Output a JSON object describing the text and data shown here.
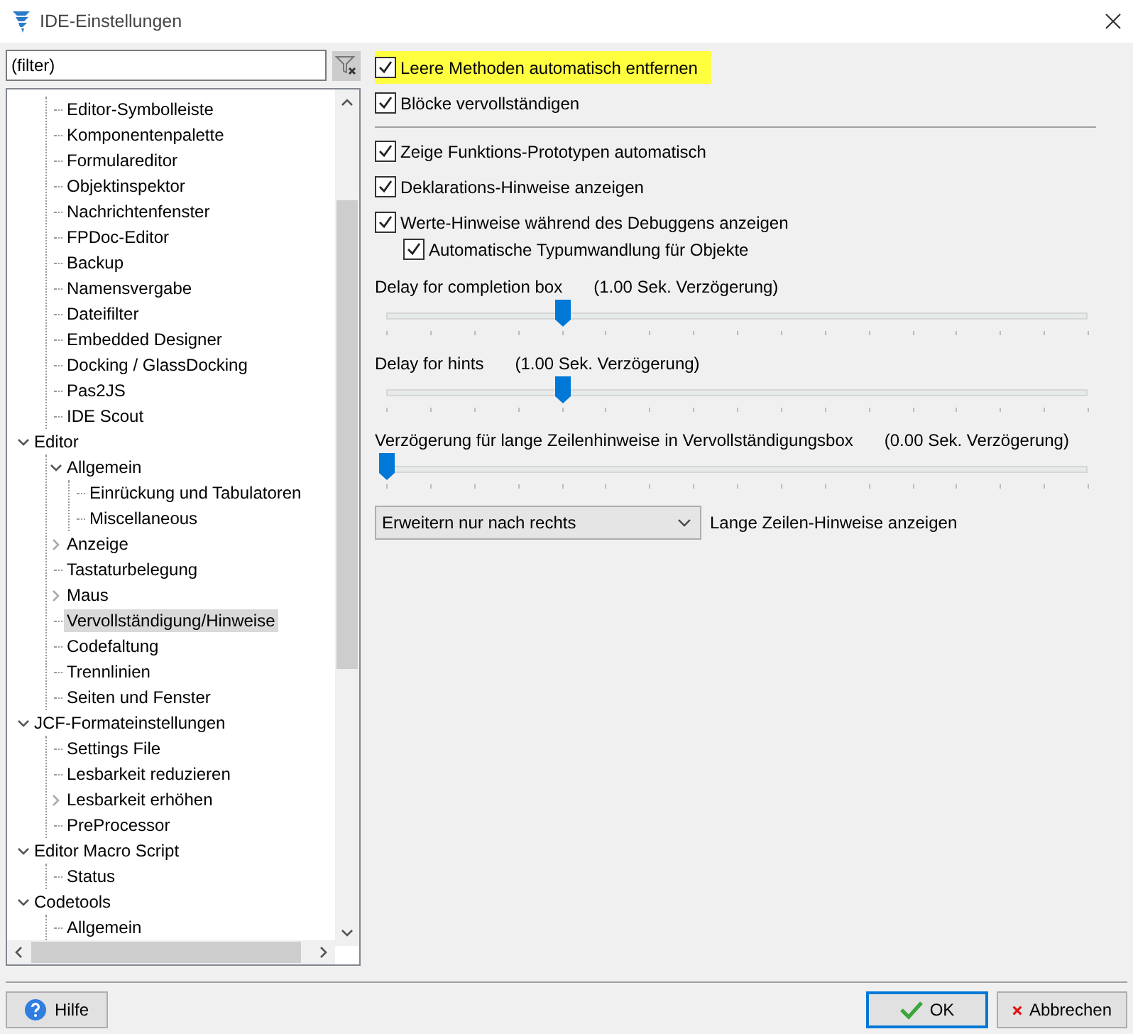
{
  "window": {
    "title": "IDE-Einstellungen"
  },
  "filter": {
    "placeholder": "(filter)"
  },
  "tree": [
    {
      "children": [
        {
          "label": "Editor-Symbolleiste",
          "selected": false
        },
        {
          "label": "Komponentenpalette",
          "selected": false
        },
        {
          "label": "Formulareditor",
          "selected": false
        },
        {
          "label": "Objektinspektor",
          "selected": false
        },
        {
          "label": "Nachrichtenfenster",
          "selected": false
        },
        {
          "label": "FPDoc-Editor",
          "selected": false
        },
        {
          "label": "Backup",
          "selected": false
        },
        {
          "label": "Namensvergabe",
          "selected": false
        },
        {
          "label": "Dateifilter",
          "selected": false
        },
        {
          "label": "Embedded Designer",
          "selected": false
        },
        {
          "label": "Docking / GlassDocking",
          "selected": false
        },
        {
          "label": "Pas2JS",
          "selected": false
        },
        {
          "label": "IDE Scout",
          "selected": false
        }
      ]
    },
    {
      "label": "Editor",
      "expanded": true,
      "selected": false,
      "children": [
        {
          "label": "Allgemein",
          "expanded": true,
          "selected": false,
          "children": [
            {
              "label": "Einrückung und Tabulatoren",
              "selected": false
            },
            {
              "label": "Miscellaneous",
              "selected": false
            }
          ]
        },
        {
          "label": "Anzeige",
          "expanded": false,
          "selected": false
        },
        {
          "label": "Tastaturbelegung",
          "selected": false
        },
        {
          "label": "Maus",
          "expanded": false,
          "selected": false
        },
        {
          "label": "Vervollständigung/Hinweise",
          "selected": true
        },
        {
          "label": "Codefaltung",
          "selected": false
        },
        {
          "label": "Trennlinien",
          "selected": false
        },
        {
          "label": "Seiten und Fenster",
          "selected": false
        }
      ]
    },
    {
      "label": "JCF-Formateinstellungen",
      "expanded": true,
      "selected": false,
      "children": [
        {
          "label": "Settings File",
          "selected": false
        },
        {
          "label": "Lesbarkeit reduzieren",
          "selected": false
        },
        {
          "label": "Lesbarkeit erhöhen",
          "expanded": false,
          "selected": false
        },
        {
          "label": "PreProcessor",
          "selected": false
        }
      ]
    },
    {
      "label": "Editor Macro Script",
      "expanded": true,
      "selected": false,
      "children": [
        {
          "label": "Status",
          "selected": false
        }
      ]
    },
    {
      "label": "Codetools",
      "expanded": true,
      "selected": false,
      "children": [
        {
          "label": "Allgemein",
          "selected": false
        }
      ]
    }
  ],
  "options": [
    {
      "kind": "checkbox",
      "label": "Leere Methoden automatisch entfernen",
      "checked": true,
      "highlighted": true
    },
    {
      "kind": "checkbox",
      "label": "Blöcke vervollständigen",
      "checked": true,
      "highlighted": false
    },
    {
      "kind": "separator"
    },
    {
      "kind": "checkbox",
      "label": "Zeige Funktions-Prototypen automatisch",
      "checked": true,
      "highlighted": false
    },
    {
      "kind": "checkbox",
      "label": "Deklarations-Hinweise anzeigen",
      "checked": true,
      "highlighted": false
    },
    {
      "kind": "checkbox",
      "label": "Werte-Hinweise während des Debuggens anzeigen",
      "checked": true,
      "highlighted": false,
      "children": [
        {
          "kind": "checkbox",
          "label": "Automatische Typumwandlung für Objekte",
          "checked": true,
          "highlighted": false
        }
      ]
    },
    {
      "kind": "slider",
      "label": "Delay for completion box",
      "reading": "(1.00 Sek. Verzögerung)",
      "level": 0.25
    },
    {
      "kind": "slider",
      "label": "Delay for hints",
      "reading": "(1.00 Sek. Verzögerung)",
      "level": 0.25
    },
    {
      "kind": "slider",
      "label": "Verzögerung für lange Zeilenhinweise in Vervollständigungsbox",
      "reading": "(0.00 Sek. Verzögerung)",
      "level": 0
    },
    {
      "kind": "combo",
      "value": "Erweitern nur nach rechts",
      "label": "Lange Zeilen-Hinweise anzeigen"
    }
  ],
  "help_button": {
    "label": "Hilfe"
  },
  "buttons": [
    {
      "kind": "ok",
      "label": "OK",
      "default": true
    },
    {
      "kind": "cancel",
      "label": "Abbrechen",
      "default": false
    }
  ]
}
